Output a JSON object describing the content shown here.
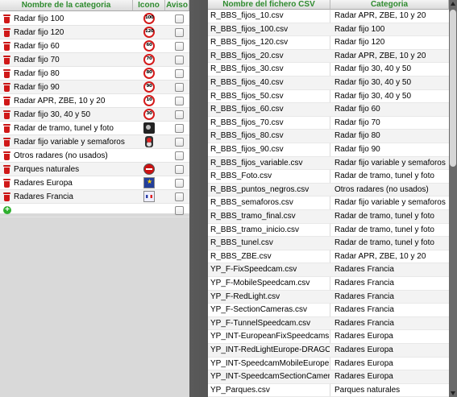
{
  "left": {
    "headers": {
      "name": "Nombre de la categoria",
      "icon": "Icono",
      "warning": "Aviso"
    },
    "rows": [
      {
        "name": "Radar fijo 100",
        "icon": "speed-100-icon",
        "icon_text": "100"
      },
      {
        "name": "Radar fijo 120",
        "icon": "speed-120-icon",
        "icon_text": "120"
      },
      {
        "name": "Radar fijo 60",
        "icon": "speed-60-icon",
        "icon_text": "60"
      },
      {
        "name": "Radar fijo 70",
        "icon": "speed-70-icon",
        "icon_text": "70"
      },
      {
        "name": "Radar fijo 80",
        "icon": "speed-80-icon",
        "icon_text": "80"
      },
      {
        "name": "Radar fijo 90",
        "icon": "speed-90-icon",
        "icon_text": "90"
      },
      {
        "name": "Radar APR, ZBE, 10 y 20",
        "icon": "speed-10-icon",
        "icon_text": "10"
      },
      {
        "name": "Radar fijo 30, 40 y 50",
        "icon": "speed-30-icon",
        "icon_text": "30"
      },
      {
        "name": "Radar de tramo, tunel y foto",
        "icon": "camera-icon",
        "icon_text": ""
      },
      {
        "name": "Radar fijo variable y semaforos",
        "icon": "traffic-light-icon",
        "icon_text": ""
      },
      {
        "name": "Otros radares (no usados)",
        "icon": "",
        "icon_text": ""
      },
      {
        "name": "Parques naturales",
        "icon": "no-entry-icon",
        "icon_text": ""
      },
      {
        "name": "Radares Europa",
        "icon": "eu-flag-icon",
        "icon_text": ""
      },
      {
        "name": "Radares Francia",
        "icon": "france-flag-icon",
        "icon_text": ""
      }
    ]
  },
  "right": {
    "headers": {
      "file": "Nombre del fichero CSV",
      "category": "Categoria"
    },
    "rows": [
      {
        "file": "R_BBS_fijos_10.csv",
        "category": "Radar APR, ZBE, 10 y 20"
      },
      {
        "file": "R_BBS_fijos_100.csv",
        "category": "Radar fijo 100"
      },
      {
        "file": "R_BBS_fijos_120.csv",
        "category": "Radar fijo 120"
      },
      {
        "file": "R_BBS_fijos_20.csv",
        "category": "Radar APR, ZBE, 10 y 20"
      },
      {
        "file": "R_BBS_fijos_30.csv",
        "category": "Radar fijo 30, 40 y 50"
      },
      {
        "file": "R_BBS_fijos_40.csv",
        "category": "Radar fijo 30, 40 y 50"
      },
      {
        "file": "R_BBS_fijos_50.csv",
        "category": "Radar fijo 30, 40 y 50"
      },
      {
        "file": "R_BBS_fijos_60.csv",
        "category": "Radar fijo 60"
      },
      {
        "file": "R_BBS_fijos_70.csv",
        "category": "Radar fijo 70"
      },
      {
        "file": "R_BBS_fijos_80.csv",
        "category": "Radar fijo 80"
      },
      {
        "file": "R_BBS_fijos_90.csv",
        "category": "Radar fijo 90"
      },
      {
        "file": "R_BBS_fijos_variable.csv",
        "category": "Radar fijo variable y semaforos"
      },
      {
        "file": "R_BBS_Foto.csv",
        "category": "Radar de tramo, tunel y foto"
      },
      {
        "file": "R_BBS_puntos_negros.csv",
        "category": "Otros radares (no usados)"
      },
      {
        "file": "R_BBS_semaforos.csv",
        "category": "Radar fijo variable y semaforos"
      },
      {
        "file": "R_BBS_tramo_final.csv",
        "category": "Radar de tramo, tunel y foto"
      },
      {
        "file": "R_BBS_tramo_inicio.csv",
        "category": "Radar de tramo, tunel y foto"
      },
      {
        "file": "R_BBS_tunel.csv",
        "category": "Radar de tramo, tunel y foto"
      },
      {
        "file": "R_BBS_ZBE.csv",
        "category": "Radar APR, ZBE, 10 y 20"
      },
      {
        "file": "YP_F-FixSpeedcam.csv",
        "category": "Radares Francia"
      },
      {
        "file": "YP_F-MobileSpeedcam.csv",
        "category": "Radares Francia"
      },
      {
        "file": "YP_F-RedLight.csv",
        "category": "Radares Francia"
      },
      {
        "file": "YP_F-SectionCameras.csv",
        "category": "Radares Francia"
      },
      {
        "file": "YP_F-TunnelSpeedcam.csv",
        "category": "Radares Francia"
      },
      {
        "file": "YP_INT-EuropeanFixSpeedcams....",
        "category": "Radares Europa"
      },
      {
        "file": "YP_INT-RedLightEurope-DRAGO....",
        "category": "Radares Europa"
      },
      {
        "file": "YP_INT-SpeedcamMobileEurope....",
        "category": "Radares Europa"
      },
      {
        "file": "YP_INT-SpeedcamSectionCamer....",
        "category": "Radares Europa"
      },
      {
        "file": "YP_Parques.csv",
        "category": "Parques naturales"
      }
    ]
  },
  "colors": {
    "header_text": "#2e8b2e",
    "trash": "#d01818",
    "add": "#2fb02f"
  }
}
